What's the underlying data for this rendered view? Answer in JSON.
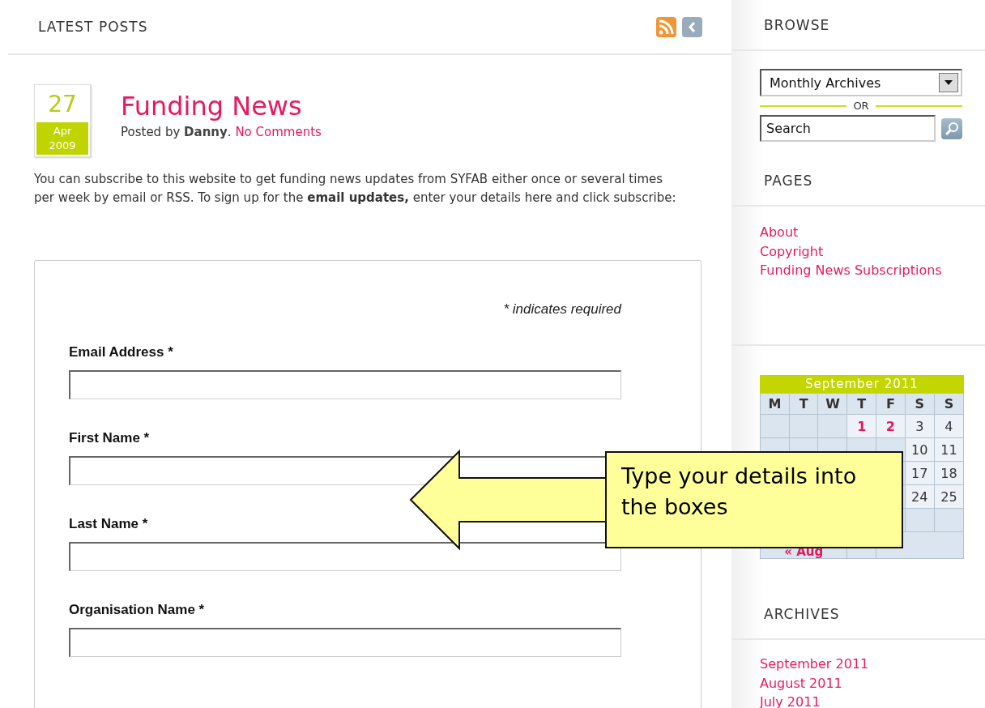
{
  "main": {
    "heading": "LATEST POSTS",
    "post": {
      "day": "27",
      "month": "Apr",
      "year": "2009",
      "title": "Funding News",
      "posted_by": "Posted by",
      "author": "Danny",
      "separator": ".",
      "comments": "No Comments",
      "body": "You can subscribe to this website to get funding news updates from SYFAB either once or several times per week by email or RSS. To sign up for the **email updates,** enter your details here and click subscribe:"
    },
    "form": {
      "required_note": "* indicates required",
      "fields": [
        {
          "label": "Email Address",
          "required_mark": "*"
        },
        {
          "label": "First Name",
          "required_mark": "*"
        },
        {
          "label": "Last Name",
          "required_mark": "*"
        },
        {
          "label": "Organisation Name",
          "required_mark": "*"
        }
      ]
    }
  },
  "sidebar": {
    "browse": {
      "heading": "BROWSE",
      "select_value": "Monthly Archives",
      "or": "OR",
      "search_placeholder": "Search"
    },
    "pages": {
      "heading": "PAGES",
      "links": [
        "About",
        "Copyright",
        "Funding News Subscriptions"
      ]
    },
    "calendar": {
      "title": "September 2011",
      "weekdays": [
        "M",
        "T",
        "W",
        "T",
        "F",
        "S",
        "S"
      ],
      "weeks": [
        [
          {
            "kind": "blank"
          },
          {
            "kind": "blank"
          },
          {
            "kind": "blank"
          },
          {
            "kind": "day",
            "day": "1",
            "linked": true
          },
          {
            "kind": "day",
            "day": "2",
            "linked": true
          },
          {
            "kind": "day",
            "day": "3",
            "linked": false
          },
          {
            "kind": "day",
            "day": "4",
            "linked": false
          }
        ],
        [
          {
            "kind": "blank"
          },
          {
            "kind": "blank"
          },
          {
            "kind": "blank"
          },
          {
            "kind": "blank"
          },
          {
            "kind": "blank"
          },
          {
            "kind": "day",
            "day": "10",
            "linked": false
          },
          {
            "kind": "day",
            "day": "11",
            "linked": false
          }
        ],
        [
          {
            "kind": "blank"
          },
          {
            "kind": "blank"
          },
          {
            "kind": "blank"
          },
          {
            "kind": "blank"
          },
          {
            "kind": "blank"
          },
          {
            "kind": "day",
            "day": "17",
            "linked": false
          },
          {
            "kind": "day",
            "day": "18",
            "linked": false
          }
        ],
        [
          {
            "kind": "blank"
          },
          {
            "kind": "blank"
          },
          {
            "kind": "blank"
          },
          {
            "kind": "blank"
          },
          {
            "kind": "blank"
          },
          {
            "kind": "day",
            "day": "24",
            "linked": false
          },
          {
            "kind": "day",
            "day": "25",
            "linked": false
          }
        ],
        [
          {
            "kind": "blank"
          },
          {
            "kind": "blank"
          },
          {
            "kind": "blank"
          },
          {
            "kind": "blank"
          },
          {
            "kind": "blank"
          },
          {
            "kind": "blank"
          },
          {
            "kind": "blank"
          }
        ]
      ],
      "prev": "« Aug"
    },
    "archives": {
      "heading": "ARCHIVES",
      "links": [
        "September 2011",
        "August 2011",
        "July 2011"
      ]
    }
  },
  "callout": {
    "text": "Type your details into the boxes"
  }
}
